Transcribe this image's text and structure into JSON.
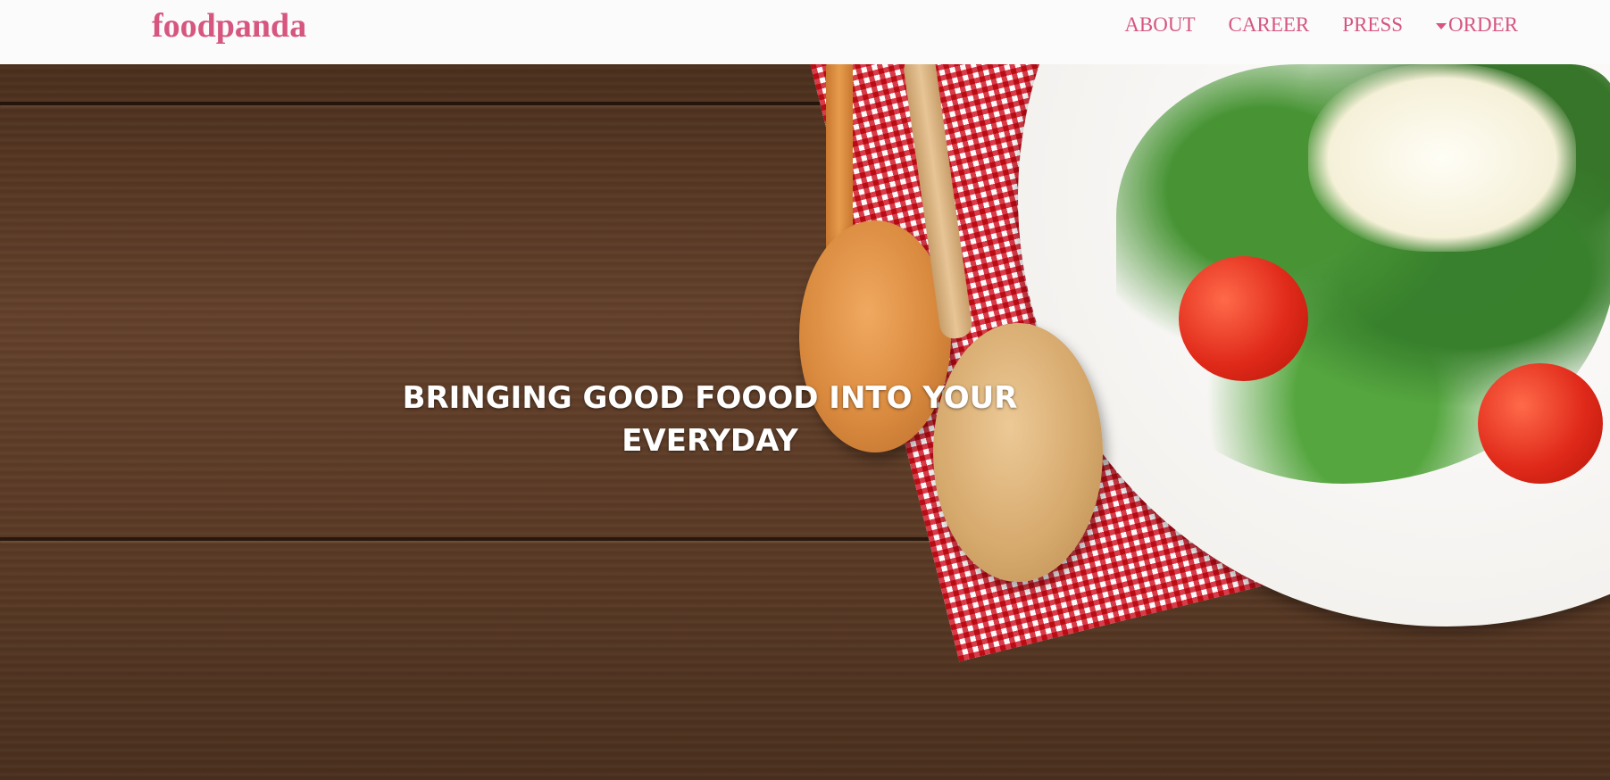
{
  "brand": {
    "name": "foodpanda",
    "color": "#d6567f"
  },
  "nav": {
    "items": [
      {
        "label": "ABOUT"
      },
      {
        "label": "CAREER"
      },
      {
        "label": "PRESS"
      },
      {
        "label": "ORDER",
        "icon": "caret-down-icon"
      }
    ]
  },
  "hero": {
    "title_line1": "BRINGING GOOD FOOOD INTO YOUR",
    "title_line2": "EVERYDAY",
    "background": "wooden table with salad plate, wooden spoons and checkered napkin"
  }
}
